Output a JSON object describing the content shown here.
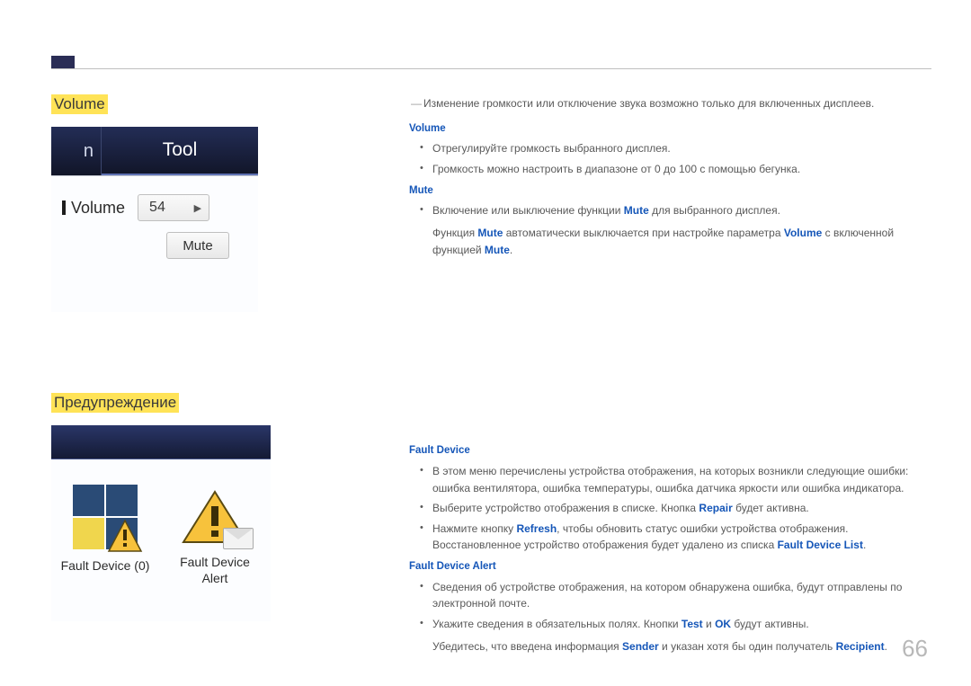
{
  "page_number": "66",
  "sections": {
    "volume": {
      "heading": "Volume",
      "note": "Изменение громкости или отключение звука возможно только для включенных дисплеев.",
      "subhead1": "Volume",
      "sub1_b1": "Отрегулируйте громкость выбранного дисплея.",
      "sub1_b2": "Громкость можно настроить в диапазоне от 0 до 100 с помощью бегунка.",
      "subhead2": "Mute",
      "sub2_b1_pre": "Включение или выключение функции ",
      "sub2_b1_kw": "Mute",
      "sub2_b1_post": " для выбранного дисплея.",
      "sub2_p2_a": "Функция ",
      "sub2_p2_b": "Mute",
      "sub2_p2_c": " автоматически выключается при настройке параметра ",
      "sub2_p2_d": "Volume",
      "sub2_p2_e": " с включенной функцией ",
      "sub2_p2_f": "Mute",
      "sub2_p2_g": "."
    },
    "warning": {
      "heading": "Предупреждение",
      "subhead1": "Fault Device",
      "fd_b1": "В этом меню перечислены устройства отображения, на которых возникли следующие ошибки: ошибка вентилятора, ошибка температуры, ошибка датчика яркости или ошибка индикатора.",
      "fd_b2_a": "Выберите устройство отображения в списке. Кнопка ",
      "fd_b2_kw": "Repair",
      "fd_b2_b": " будет активна.",
      "fd_b3_a": "Нажмите кнопку ",
      "fd_b3_kw1": "Refresh",
      "fd_b3_b": ", чтобы обновить статус ошибки устройства отображения. Восстановленное устройство отображения будет удалено из списка ",
      "fd_b3_kw2": "Fault Device List",
      "fd_b3_c": ".",
      "subhead2": "Fault Device Alert",
      "fda_b1": "Сведения об устройстве отображения, на котором обнаружена ошибка, будут отправлены по электронной почте.",
      "fda_b2_a": "Укажите сведения в обязательных полях. Кнопки ",
      "fda_b2_kw1": "Test",
      "fda_b2_mid": " и ",
      "fda_b2_kw2": "OK",
      "fda_b2_b": " будут активны.",
      "fda_p3_a": "Убедитесь, что введена информация ",
      "fda_p3_kw1": "Sender",
      "fda_p3_b": " и указан хотя бы один получатель ",
      "fda_p3_kw2": "Recipient",
      "fda_p3_c": "."
    }
  },
  "screenshot_volume": {
    "tab_left": "n",
    "tab_active": "Tool",
    "volume_label": "Volume",
    "volume_value": "54",
    "mute_button": "Mute"
  },
  "screenshot_warning": {
    "fault_device_label": "Fault Device (0)",
    "fault_device_alert_label": "Fault Device Alert"
  }
}
